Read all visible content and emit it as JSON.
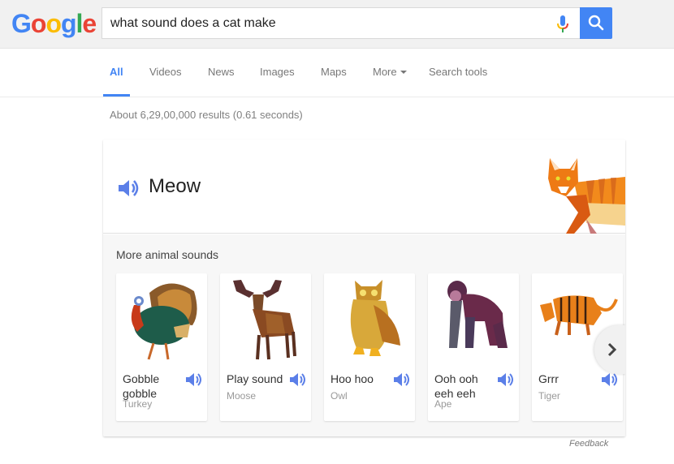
{
  "header": {
    "logo_letters": [
      "G",
      "o",
      "o",
      "g",
      "l",
      "e"
    ],
    "logo_colors": [
      "#4285f4",
      "#ea4335",
      "#fbbc05",
      "#4285f4",
      "#34a853",
      "#ea4335"
    ],
    "search_value": "what sound does a cat make",
    "mic_icon": "microphone-icon",
    "search_icon": "magnifier-icon",
    "accent_color": "#4285f4"
  },
  "tabs": {
    "items": [
      {
        "label": "All",
        "active": true
      },
      {
        "label": "Videos",
        "active": false
      },
      {
        "label": "News",
        "active": false
      },
      {
        "label": "Images",
        "active": false
      },
      {
        "label": "Maps",
        "active": false
      },
      {
        "label": "More",
        "active": false
      },
      {
        "label": "Search tools",
        "active": false
      }
    ]
  },
  "stats": {
    "text": "About 6,29,00,000 results (0.61 seconds)"
  },
  "answer": {
    "sound": "Meow",
    "animal": "Cat",
    "speaker_icon": "speaker-icon",
    "more_label": "More animal sounds",
    "animals": [
      {
        "sound": "Gobble gobble",
        "name": "Turkey"
      },
      {
        "sound": "Play sound",
        "name": "Moose"
      },
      {
        "sound": "Hoo hoo",
        "name": "Owl"
      },
      {
        "sound": "Ooh ooh eeh eeh",
        "name": "Ape"
      },
      {
        "sound": "Grrr",
        "name": "Tiger"
      }
    ],
    "next_icon": "chevron-right-icon"
  },
  "footer": {
    "feedback": "Feedback"
  }
}
